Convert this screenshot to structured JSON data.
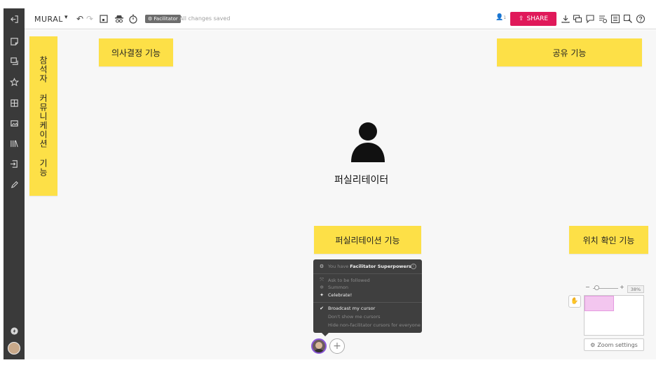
{
  "toolbar": {
    "brand": "MURAL",
    "facilitator_badge": "Facilitator",
    "save_status": "All changes saved",
    "user_count": "1",
    "share_label": "SHARE"
  },
  "stickies": {
    "decision": "의사결정 기능",
    "share": "공유 기능",
    "communication": "참석자 커뮤니케이션 기능",
    "facilitation": "퍼실리테이션 기능",
    "location": "위치 확인 기능"
  },
  "center_label": "퍼실리테이터",
  "menu": {
    "header_prefix": "You have",
    "header_bold": "Facilitator Superpowers",
    "items": [
      {
        "label": "Ask to be followed",
        "icon": "follow-icon",
        "state": "dim"
      },
      {
        "label": "Summon",
        "icon": "summon-icon",
        "state": "dim"
      },
      {
        "label": "Celebrate!",
        "icon": "party-icon",
        "state": "bright"
      },
      {
        "label": "Broadcast my cursor",
        "icon": "check-icon",
        "state": "bright"
      },
      {
        "label": "Don't show me cursors",
        "icon": "",
        "state": "dim"
      },
      {
        "label": "Hide non-facilitator cursors for everyone",
        "icon": "",
        "state": "dim"
      }
    ]
  },
  "zoom": {
    "percent": "38%",
    "settings_label": "Zoom settings"
  },
  "colors": {
    "sticky": "#fde047",
    "share_button": "#e0195a",
    "sidebar": "#3a3a3a"
  }
}
